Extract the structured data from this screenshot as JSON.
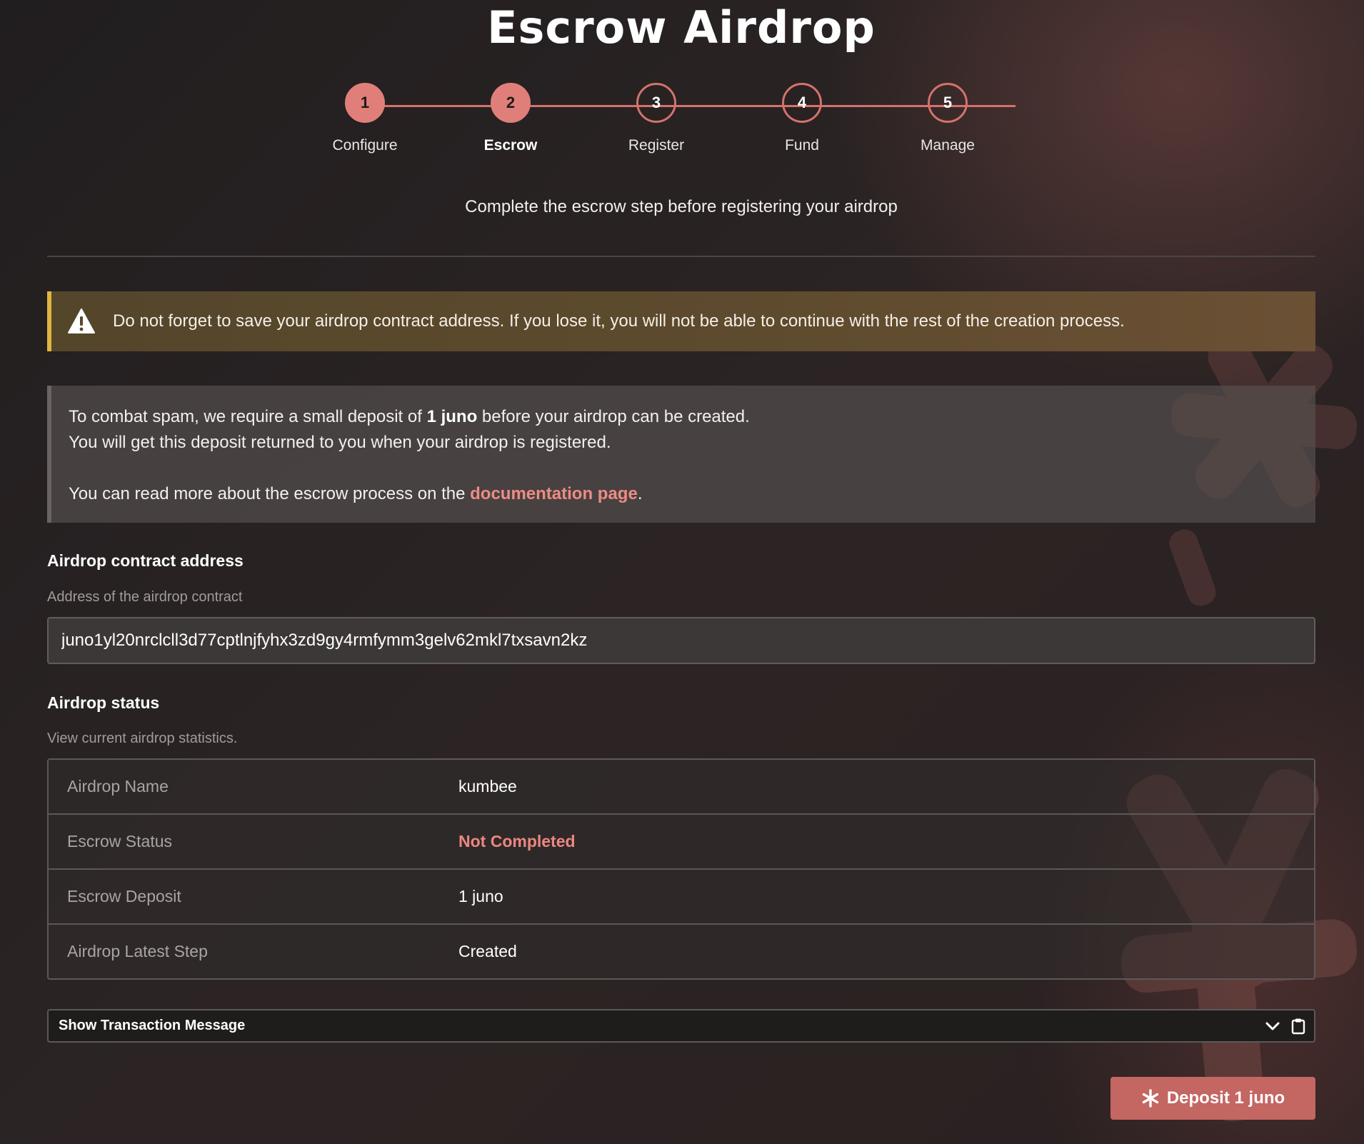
{
  "header": {
    "title": "Escrow Airdrop"
  },
  "stepper": {
    "steps": [
      {
        "number": "1",
        "label": "Configure"
      },
      {
        "number": "2",
        "label": "Escrow"
      },
      {
        "number": "3",
        "label": "Register"
      },
      {
        "number": "4",
        "label": "Fund"
      },
      {
        "number": "5",
        "label": "Manage"
      }
    ],
    "current_step": 2,
    "subtitle": "Complete the escrow step before registering your airdrop"
  },
  "warning": {
    "icon": "warning-triangle-icon",
    "text": "Do not forget to save your airdrop contract address. If you lose it, you will not be able to continue with the rest of the creation process."
  },
  "info": {
    "line1_prefix": "To combat spam, we require a small deposit of ",
    "line1_amount": "1 juno",
    "line1_suffix": " before your airdrop can be created.",
    "line2": "You will get this deposit returned to you when your airdrop is registered.",
    "line3_prefix": "You can read more about the escrow process on the ",
    "line3_link": "documentation page",
    "line3_suffix": "."
  },
  "contract_address": {
    "label": "Airdrop contract address",
    "help": "Address of the airdrop contract",
    "value": "juno1yl20nrclcll3d77cptlnjfyhx3zd9gy4rmfymm3gelv62mkl7txsavn2kz"
  },
  "airdrop_status": {
    "label": "Airdrop status",
    "help": "View current airdrop statistics.",
    "rows": [
      {
        "key": "Airdrop Name",
        "value": "kumbee"
      },
      {
        "key": "Escrow Status",
        "value": "Not Completed"
      },
      {
        "key": "Escrow Deposit",
        "value": "1 juno"
      },
      {
        "key": "Airdrop Latest Step",
        "value": "Created"
      }
    ]
  },
  "transaction": {
    "label": "Show Transaction Message",
    "icons": [
      "chevron-down-icon",
      "clipboard-icon"
    ]
  },
  "deposit_button": {
    "label": "Deposit 1 juno",
    "icon": "asterisk-icon"
  },
  "colors": {
    "accent": "#e07f79",
    "button": "#c46662",
    "warning_border": "#e2b541",
    "status_bad": "#ec8780",
    "link": "#ec8c84"
  }
}
